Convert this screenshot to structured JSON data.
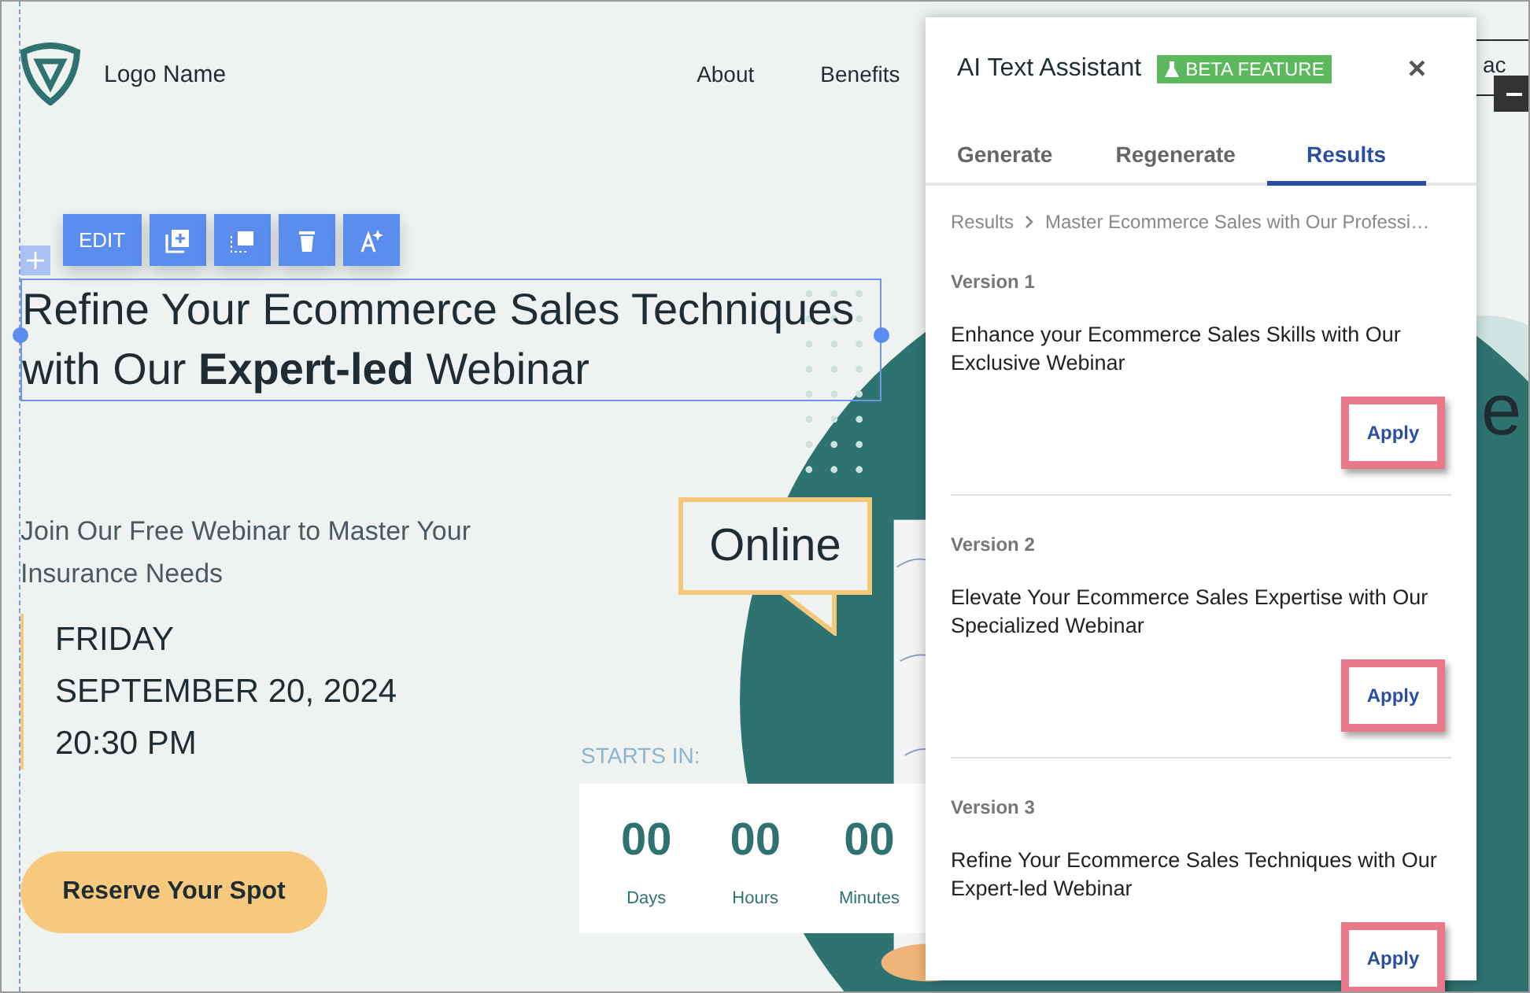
{
  "site": {
    "logo": "Logo Name",
    "nav": [
      "About",
      "Benefits"
    ],
    "header_button": "ac",
    "side_text": "e"
  },
  "toolbar": {
    "edit": "EDIT"
  },
  "hero": {
    "heading": "Refine Your Ecommerce Sales Techniques with Our **Expert-led** Webinar",
    "subtitle": "Join Our Free Webinar to Master Your Insurance Needs",
    "date_lines": [
      "FRIDAY",
      "SEPTEMBER 20, 2024",
      "20:30 PM"
    ],
    "cta": "Reserve Your Spot",
    "badge": "Online",
    "countdown": {
      "label": "STARTS IN:",
      "units": [
        {
          "value": "00",
          "label": "Days"
        },
        {
          "value": "00",
          "label": "Hours"
        },
        {
          "value": "00",
          "label": "Minutes"
        }
      ]
    }
  },
  "panel": {
    "title": "AI Text Assistant",
    "badge": "BETA FEATURE",
    "close": "×",
    "tabs": [
      {
        "label": "Generate",
        "selected": false
      },
      {
        "label": "Regenerate",
        "selected": false
      },
      {
        "label": "Results",
        "selected": true
      }
    ],
    "breadcrumb": [
      "Results",
      "Master Ecommerce Sales with Our Professi…"
    ],
    "versions": [
      {
        "label": "Version 1",
        "text": "Enhance your Ecommerce Sales Skills with Our Exclusive Webinar",
        "button": "Apply"
      },
      {
        "label": "Version 2",
        "text": "Elevate Your Ecommerce Sales Expertise with Our Specialized Webinar",
        "button": "Apply"
      },
      {
        "label": "Version 3",
        "text": "Refine Your Ecommerce Sales Techniques with Our Expert-led Webinar",
        "button": "Apply"
      }
    ]
  }
}
